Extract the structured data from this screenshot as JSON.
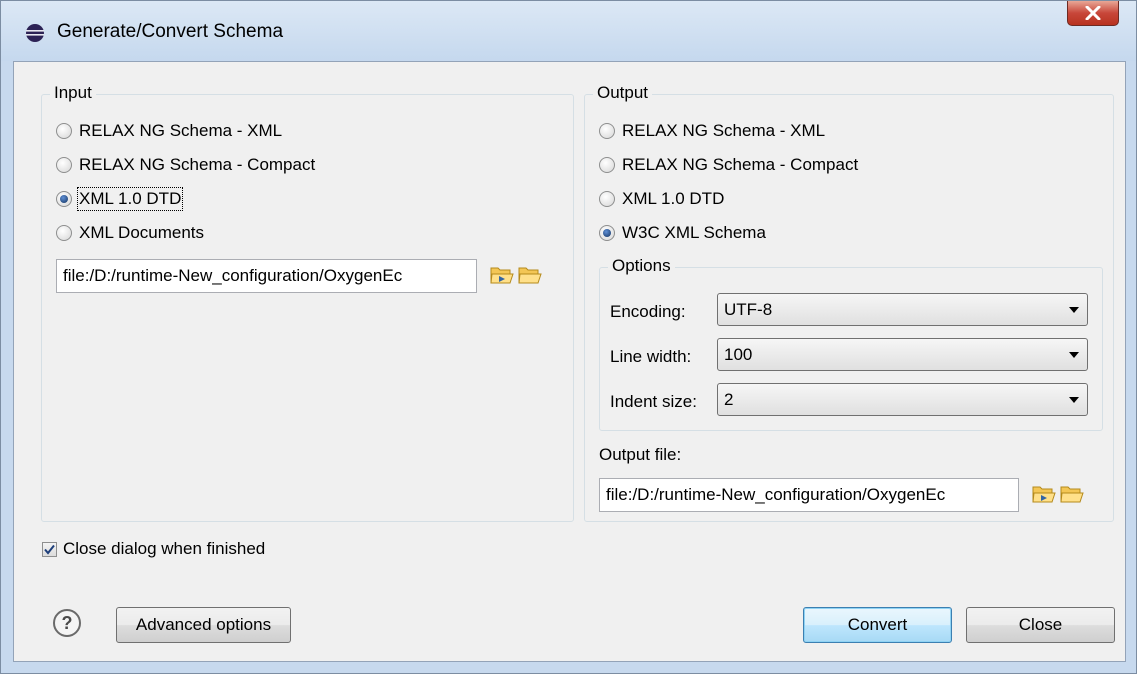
{
  "window": {
    "title": "Generate/Convert Schema"
  },
  "input": {
    "title": "Input",
    "options": [
      "RELAX NG Schema - XML",
      "RELAX NG Schema - Compact",
      "XML 1.0 DTD",
      "XML Documents"
    ],
    "selected": "XML 1.0 DTD",
    "file_value": "file:/D:/runtime-New_configuration/OxygenEc"
  },
  "output": {
    "title": "Output",
    "options": [
      "RELAX NG Schema - XML",
      "RELAX NG Schema - Compact",
      "XML 1.0 DTD",
      "W3C XML Schema"
    ],
    "selected": "W3C XML Schema",
    "options_group": {
      "title": "Options",
      "encoding_label": "Encoding:",
      "encoding_value": "UTF-8",
      "line_width_label": "Line width:",
      "line_width_value": "100",
      "indent_label": "Indent size:",
      "indent_value": "2"
    },
    "output_file_label": "Output file:",
    "output_file_value": "file:/D:/runtime-New_configuration/OxygenEc"
  },
  "close_when_finished": {
    "label": "Close dialog when finished",
    "checked": true
  },
  "buttons": {
    "advanced": "Advanced options",
    "convert": "Convert",
    "close": "Close"
  },
  "icons": [
    "eclipse-icon",
    "close-window-icon",
    "open-folder-icon",
    "browse-folder-icon",
    "help-icon",
    "checkmark-icon"
  ],
  "colors": {
    "accent": "#3c7fb1",
    "close_button": "#c8473a"
  }
}
